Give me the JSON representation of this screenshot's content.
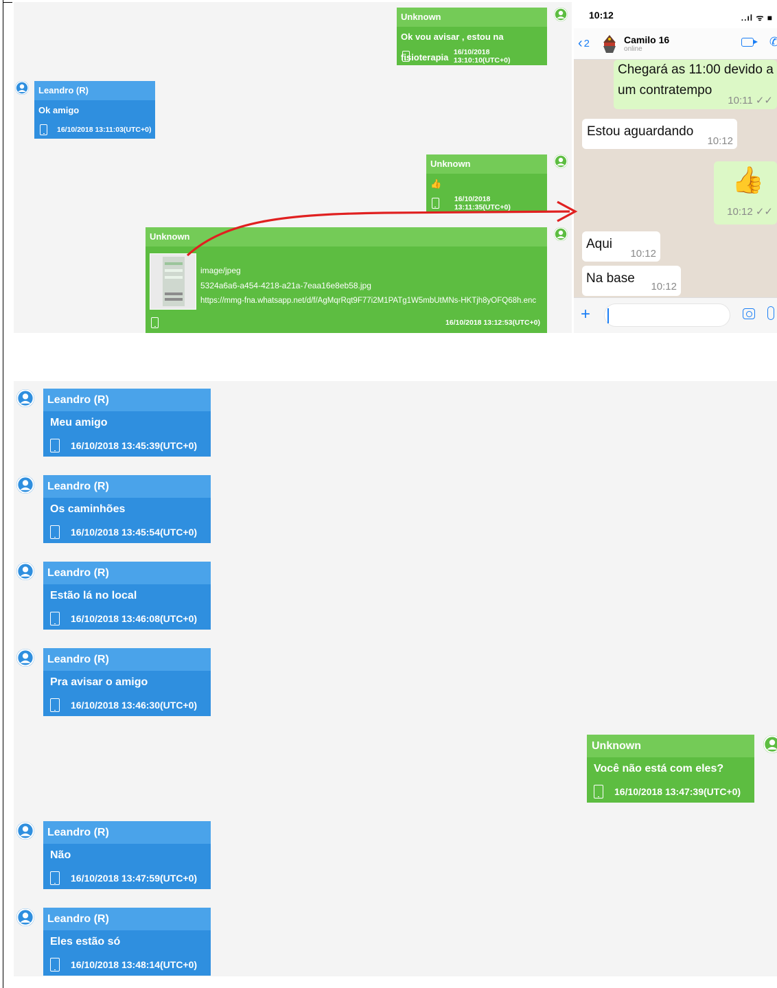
{
  "phone_screenshot": {
    "status_time": "10:12",
    "status_signal": "..ıl ᯤ ■",
    "back_count": "2",
    "contact_name": "Camilo 16",
    "contact_status": "online",
    "messages": [
      {
        "text_line1": "Chegará as 11:00 devido a",
        "text_line2": "um contratempo",
        "time": "10:11 ✓✓"
      },
      {
        "text": "Estou aguardando",
        "time": "10:12"
      },
      {
        "text": "👍",
        "time": "10:12 ✓✓"
      },
      {
        "text": "Aqui",
        "time": "10:12"
      },
      {
        "text": "Na base",
        "time": "10:12"
      }
    ]
  },
  "top_export": {
    "messages": [
      {
        "sender": "Unknown",
        "text": "Ok vou avisar , estou na fisioterapia",
        "timestamp": "16/10/2018 13:10:10(UTC+0)"
      },
      {
        "sender": "Leandro (R)",
        "text": "Ok amigo",
        "timestamp": "16/10/2018 13:11:03(UTC+0)"
      },
      {
        "sender": "Unknown",
        "text": "👍",
        "timestamp": "16/10/2018 13:11:35(UTC+0)"
      },
      {
        "sender": "Unknown",
        "attachment_type": "image/jpeg",
        "attachment_name": "5324a6a6-a454-4218-a21a-7eaa16e8eb58.jpg",
        "attachment_url": "https://mmg-fna.whatsapp.net/d/f/AgMqrRqt9F77i2M1PATg1W5mbUtMNs-HKTjh8yOFQ68h.enc",
        "timestamp": "16/10/2018 13:12:53(UTC+0)"
      }
    ]
  },
  "bottom_export": {
    "messages": [
      {
        "sender": "Leandro (R)",
        "text": "Meu amigo",
        "timestamp": "16/10/2018 13:45:39(UTC+0)"
      },
      {
        "sender": "Leandro (R)",
        "text": "Os caminhões",
        "timestamp": "16/10/2018 13:45:54(UTC+0)"
      },
      {
        "sender": "Leandro (R)",
        "text": "Estão lá no local",
        "timestamp": "16/10/2018 13:46:08(UTC+0)"
      },
      {
        "sender": "Leandro (R)",
        "text": "Pra avisar o amigo",
        "timestamp": "16/10/2018 13:46:30(UTC+0)"
      },
      {
        "sender": "Unknown",
        "text": "Você não está com eles?",
        "timestamp": "16/10/2018 13:47:39(UTC+0)"
      },
      {
        "sender": "Leandro (R)",
        "text": "Não",
        "timestamp": "16/10/2018 13:47:59(UTC+0)"
      },
      {
        "sender": "Leandro (R)",
        "text": "Eles estão só",
        "timestamp": "16/10/2018 13:48:14(UTC+0)"
      }
    ]
  },
  "colors": {
    "incoming": "#2f8fdf",
    "outgoing": "#5dbd41",
    "annotation_arrow": "#e02020",
    "whatsapp_accent": "#1a7ef5"
  }
}
